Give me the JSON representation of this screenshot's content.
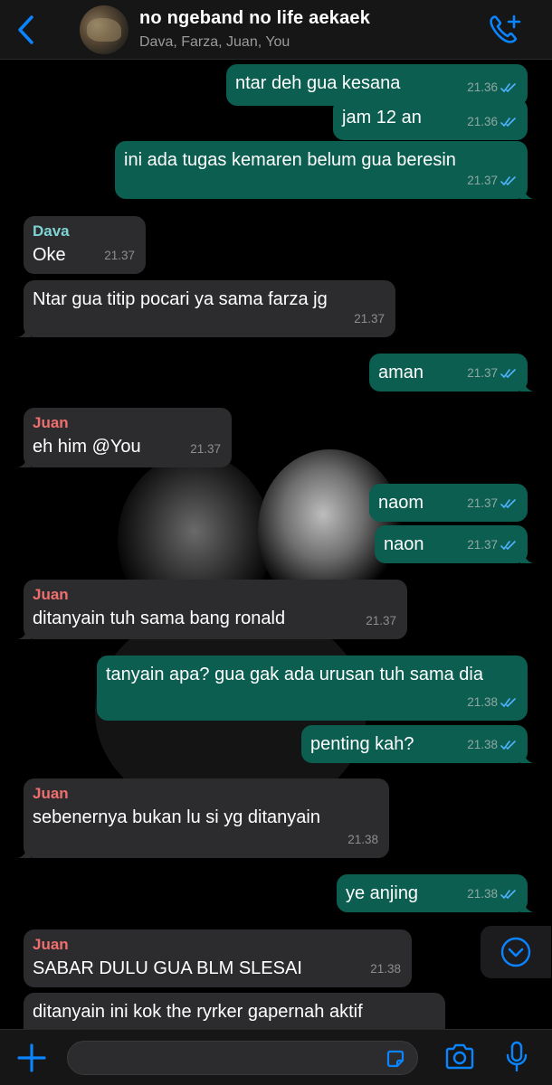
{
  "header": {
    "title": "no ngeband no life aekaek",
    "subtitle": "Dava, Farza, Juan, You",
    "back_icon": "chevron-left-icon",
    "call_icon": "phone-plus-icon",
    "accent": "#0a84ff"
  },
  "messages": [
    {
      "dir": "out",
      "text": "ntar deh gua kesana",
      "time": "21.36"
    },
    {
      "dir": "out",
      "text": "jam 12 an",
      "time": "21.36"
    },
    {
      "dir": "out",
      "text": "ini ada tugas kemaren belum gua beresin",
      "time": "21.37"
    },
    {
      "dir": "in",
      "sender": "Dava",
      "text": "Oke",
      "time": "21.37"
    },
    {
      "dir": "in",
      "text": "Ntar gua titip pocari ya sama farza jg",
      "time": "21.37"
    },
    {
      "dir": "out",
      "text": "aman",
      "time": "21.37"
    },
    {
      "dir": "in",
      "sender": "Juan",
      "text": "eh him @You",
      "time": "21.37"
    },
    {
      "dir": "out",
      "text": "naom",
      "time": "21.37"
    },
    {
      "dir": "out",
      "text": "naon",
      "time": "21.37"
    },
    {
      "dir": "in",
      "sender": "Juan",
      "text": "ditanyain tuh sama bang ronald",
      "time": "21.37"
    },
    {
      "dir": "out",
      "text": "tanyain apa? gua gak ada urusan tuh sama dia",
      "time": "21.38"
    },
    {
      "dir": "out",
      "text": "penting kah?",
      "time": "21.38"
    },
    {
      "dir": "in",
      "sender": "Juan",
      "text": "sebenernya bukan lu si yg ditanyain",
      "time": "21.38"
    },
    {
      "dir": "out",
      "text": "ye anjing",
      "time": "21.38"
    },
    {
      "dir": "in",
      "sender": "Juan",
      "text": "SABAR DULU GUA BLM SLESAI",
      "time": "21.38"
    },
    {
      "dir": "in",
      "text": "ditanyain ini kok the ryrker gapernah aktif",
      "time": ""
    }
  ],
  "colors": {
    "outgoing_bubble": "#0c5e51",
    "incoming_bubble": "#2c2c2e",
    "sender_dava": "#7fd3d3",
    "sender_juan": "#ef6f6f",
    "read_ticks": "#4fb3ff"
  },
  "composer": {
    "value": "",
    "placeholder": "",
    "plus_icon": "plus-icon",
    "sticker_icon": "sticker-icon",
    "camera_icon": "camera-icon",
    "mic_icon": "microphone-icon",
    "scroll_icon": "chevron-down-circle-icon"
  }
}
